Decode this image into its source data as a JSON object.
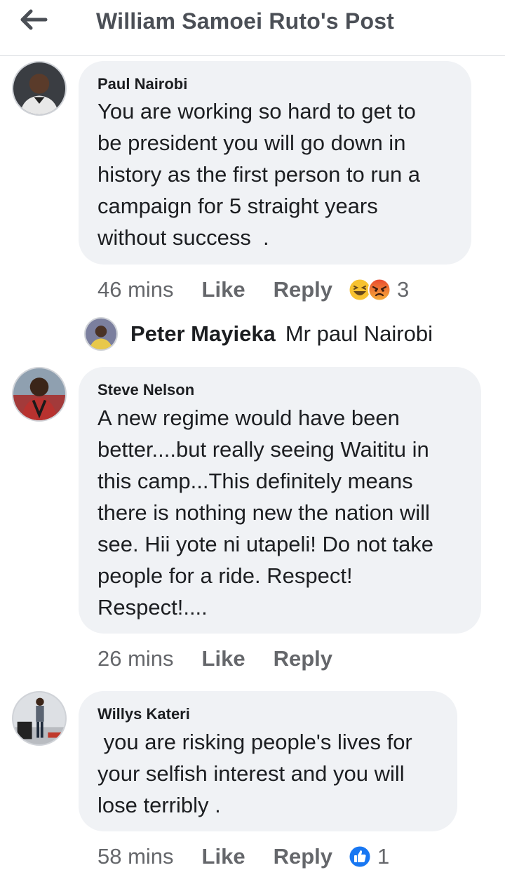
{
  "header": {
    "title": "William Samoei Ruto's Post",
    "back_icon": "arrow-left-icon"
  },
  "comments": [
    {
      "author": "Paul Nairobi",
      "text": "You are working so hard to get to\nbe president you will go down in\nhistory as the first person to run a\ncampaign for 5 straight years\nwithout success  .",
      "time": "46 mins",
      "like_label": "Like",
      "reply_label": "Reply",
      "reactions": [
        "haha-emoji",
        "angry-emoji"
      ],
      "reaction_count": "3",
      "reply_preview": {
        "name": "Peter Mayieka",
        "text": "Mr paul Nairobi"
      }
    },
    {
      "author": "Steve Nelson",
      "text": "A new regime would have been\nbetter....but really seeing Waititu in\nthis camp...This definitely means\nthere is nothing new the nation will\nsee. Hii yote ni utapeli! Do not take\npeople for a ride. Respect!\nRespect!....",
      "time": "26 mins",
      "like_label": "Like",
      "reply_label": "Reply"
    },
    {
      "author": "Willys Kateri",
      "text": " you are risking people's lives for\nyour selfish interest and you will\nlose terribly .",
      "time": "58 mins",
      "like_label": "Like",
      "reply_label": "Reply",
      "reactions": [
        "like-emoji"
      ],
      "reaction_count": "1"
    }
  ],
  "colors": {
    "bubble": "#f0f2f5",
    "meta_text": "#65676b",
    "like_blue": "#1877f2",
    "header_text": "#4b4f56"
  }
}
